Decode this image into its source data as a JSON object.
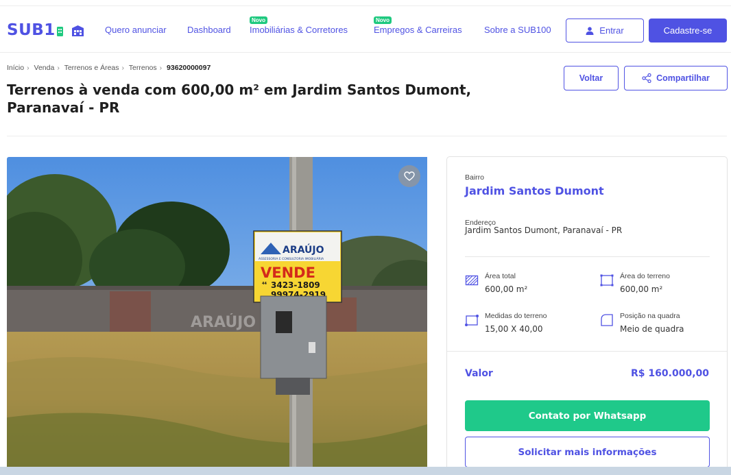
{
  "header": {
    "logo_text": "SUB1",
    "nav": [
      {
        "label": "Quero anunciar",
        "badge": ""
      },
      {
        "label": "Dashboard",
        "badge": ""
      },
      {
        "label": "Imobiliárias & Corretores",
        "badge": "Novo"
      },
      {
        "label": "Empregos & Carreiras",
        "badge": "Novo"
      },
      {
        "label": "Sobre a SUB100",
        "badge": ""
      }
    ],
    "login_label": "Entrar",
    "signup_label": "Cadastre-se"
  },
  "breadcrumb": {
    "items": [
      "Início",
      "Venda",
      "Terrenos e Áreas",
      "Terrenos"
    ],
    "sep": "›",
    "current": "93620000097"
  },
  "title": {
    "bold": "Terrenos à venda",
    "rest": " com 600,00 m² em Jardim Santos Dumont, Paranavaí - PR"
  },
  "actions": {
    "back_label": "Voltar",
    "share_label": "Compartilhar"
  },
  "photo": {
    "sign_brand": "ARAÚJO",
    "sign_sub": "ASSESSORIA E CONSULTORIA IMOBILIÁRIA",
    "sign_sale": "VENDE",
    "phone_1": "3423-1809",
    "phone_2": "99974-2919",
    "phone_prefix": "44",
    "watermark": "ARAÚJO"
  },
  "details": {
    "bairro_label": "Bairro",
    "bairro_value": "Jardim Santos Dumont",
    "endereco_label": "Endereço",
    "endereco_value": "Jardim Santos Dumont, Paranavaí - PR",
    "features": [
      {
        "label": "Área total",
        "value": "600,00 m²",
        "icon": "area-total-icon"
      },
      {
        "label": "Área do terreno",
        "value": "600,00 m²",
        "icon": "land-area-icon"
      },
      {
        "label": "Medidas do terreno",
        "value": "15,00 X 40,00",
        "icon": "measurements-icon"
      },
      {
        "label": "Posição na quadra",
        "value": "Meio de quadra",
        "icon": "block-position-icon"
      }
    ],
    "valor_label": "Valor",
    "valor_value": "R$ 160.000,00",
    "whatsapp_label": "Contato por Whatsapp",
    "info_label": "Solicitar mais informações"
  },
  "colors": {
    "brand": "#4f52e3",
    "green": "#1fc98a",
    "badge": "#1fc97f"
  }
}
